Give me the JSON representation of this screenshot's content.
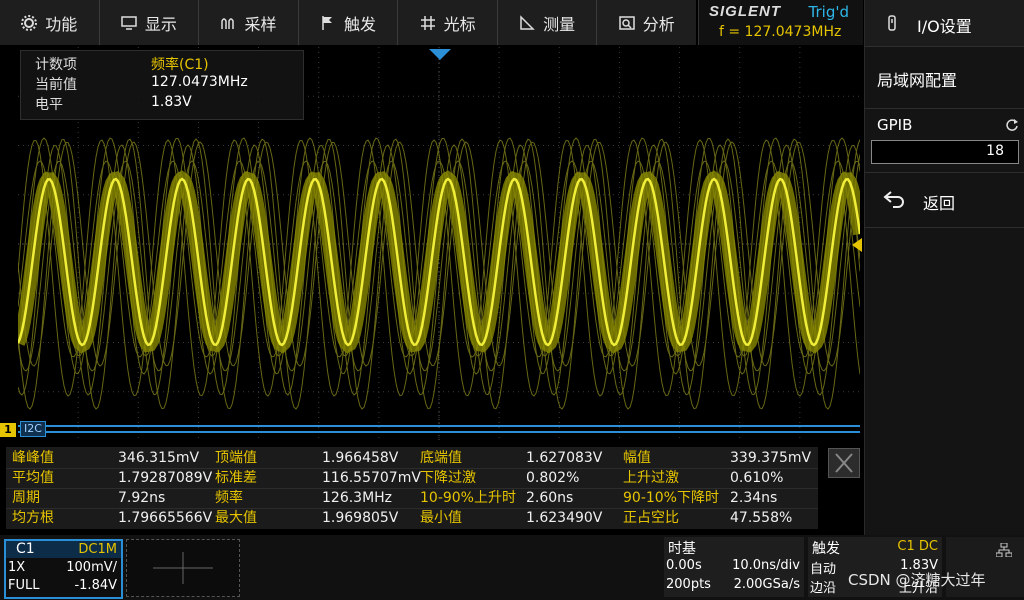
{
  "menu": [
    {
      "label": "功能",
      "icon": "gear-icon"
    },
    {
      "label": "显示",
      "icon": "monitor-icon"
    },
    {
      "label": "采样",
      "icon": "sampling-icon"
    },
    {
      "label": "触发",
      "icon": "flag-icon"
    },
    {
      "label": "光标",
      "icon": "cursor-icon"
    },
    {
      "label": "测量",
      "icon": "measure-icon"
    },
    {
      "label": "分析",
      "icon": "analysis-icon"
    }
  ],
  "brand": {
    "logo": "SIGLENT",
    "trig": "Trig'd",
    "freq": "f = 127.0473MHz"
  },
  "counter": {
    "rows": [
      {
        "k": "计数项",
        "v": "频率(C1)"
      },
      {
        "k": "当前值",
        "v": "127.0473MHz"
      },
      {
        "k": "电平",
        "v": "1.83V"
      }
    ]
  },
  "right_panel": {
    "title": "I/O设置",
    "lan": "局域网配置",
    "gpib_label": "GPIB",
    "gpib_value": "18",
    "back": "返回"
  },
  "marker_labels": {
    "ch": "1",
    "bus": "I2C"
  },
  "measurements": [
    [
      "峰峰值",
      "346.315mV",
      "顶端值",
      "1.966458V",
      "底端值",
      "1.627083V",
      "幅值",
      "339.375mV"
    ],
    [
      "平均值",
      "1.79287089V",
      "标准差",
      "116.55707mV",
      "下降过激",
      "0.802%",
      "上升过激",
      "0.610%"
    ],
    [
      "周期",
      "7.92ns",
      "频率",
      "126.3MHz",
      "10-90%上升时",
      "2.60ns",
      "90-10%下降时",
      "2.34ns"
    ],
    [
      "均方根",
      "1.79665566V",
      "最大值",
      "1.969805V",
      "最小值",
      "1.623490V",
      "正占空比",
      "47.558%"
    ]
  ],
  "channel": {
    "name": "C1",
    "coupling": "DC1M",
    "probe": "1X",
    "scale": "100mV/",
    "bw": "FULL",
    "offset": "-1.84V"
  },
  "timebase": {
    "title": "时基",
    "delay": "0.00s",
    "scale": "10.0ns/div",
    "points": "200pts",
    "rate": "2.00GSa/s"
  },
  "trigger": {
    "title": "触发",
    "source": "C1 DC",
    "mode": "自动",
    "level": "1.83V",
    "type": "边沿",
    "slope": "上升沿"
  },
  "watermark": "CSDN @济糖大过年",
  "colors": {
    "trace": "#e6c400",
    "accent": "#2a8fd6",
    "trig": "#2fb6e8"
  }
}
